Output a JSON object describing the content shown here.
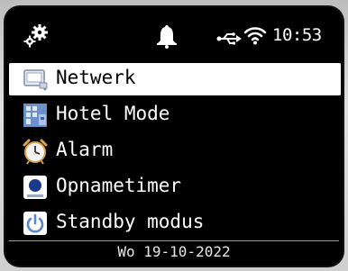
{
  "status": {
    "time": "10:53",
    "icons": [
      "settings-gears-icon",
      "alarm-bell-icon",
      "usb-icon",
      "wifi-icon"
    ]
  },
  "menu": {
    "items": [
      {
        "label": "Netwerk",
        "icon": "network-icon",
        "selected": true
      },
      {
        "label": "Hotel Mode",
        "icon": "hotel-icon",
        "selected": false
      },
      {
        "label": "Alarm",
        "icon": "alarm-clock-icon",
        "selected": false
      },
      {
        "label": "Opnametimer",
        "icon": "record-timer-icon",
        "selected": false
      },
      {
        "label": "Standby modus",
        "icon": "power-icon",
        "selected": false
      }
    ]
  },
  "footer": {
    "date": "Wo 19-10-2022"
  },
  "colors": {
    "screen_bg": "#000000",
    "text": "#ffffff",
    "highlight": "#ffffff",
    "icon_blue": "#8fb4e3"
  }
}
